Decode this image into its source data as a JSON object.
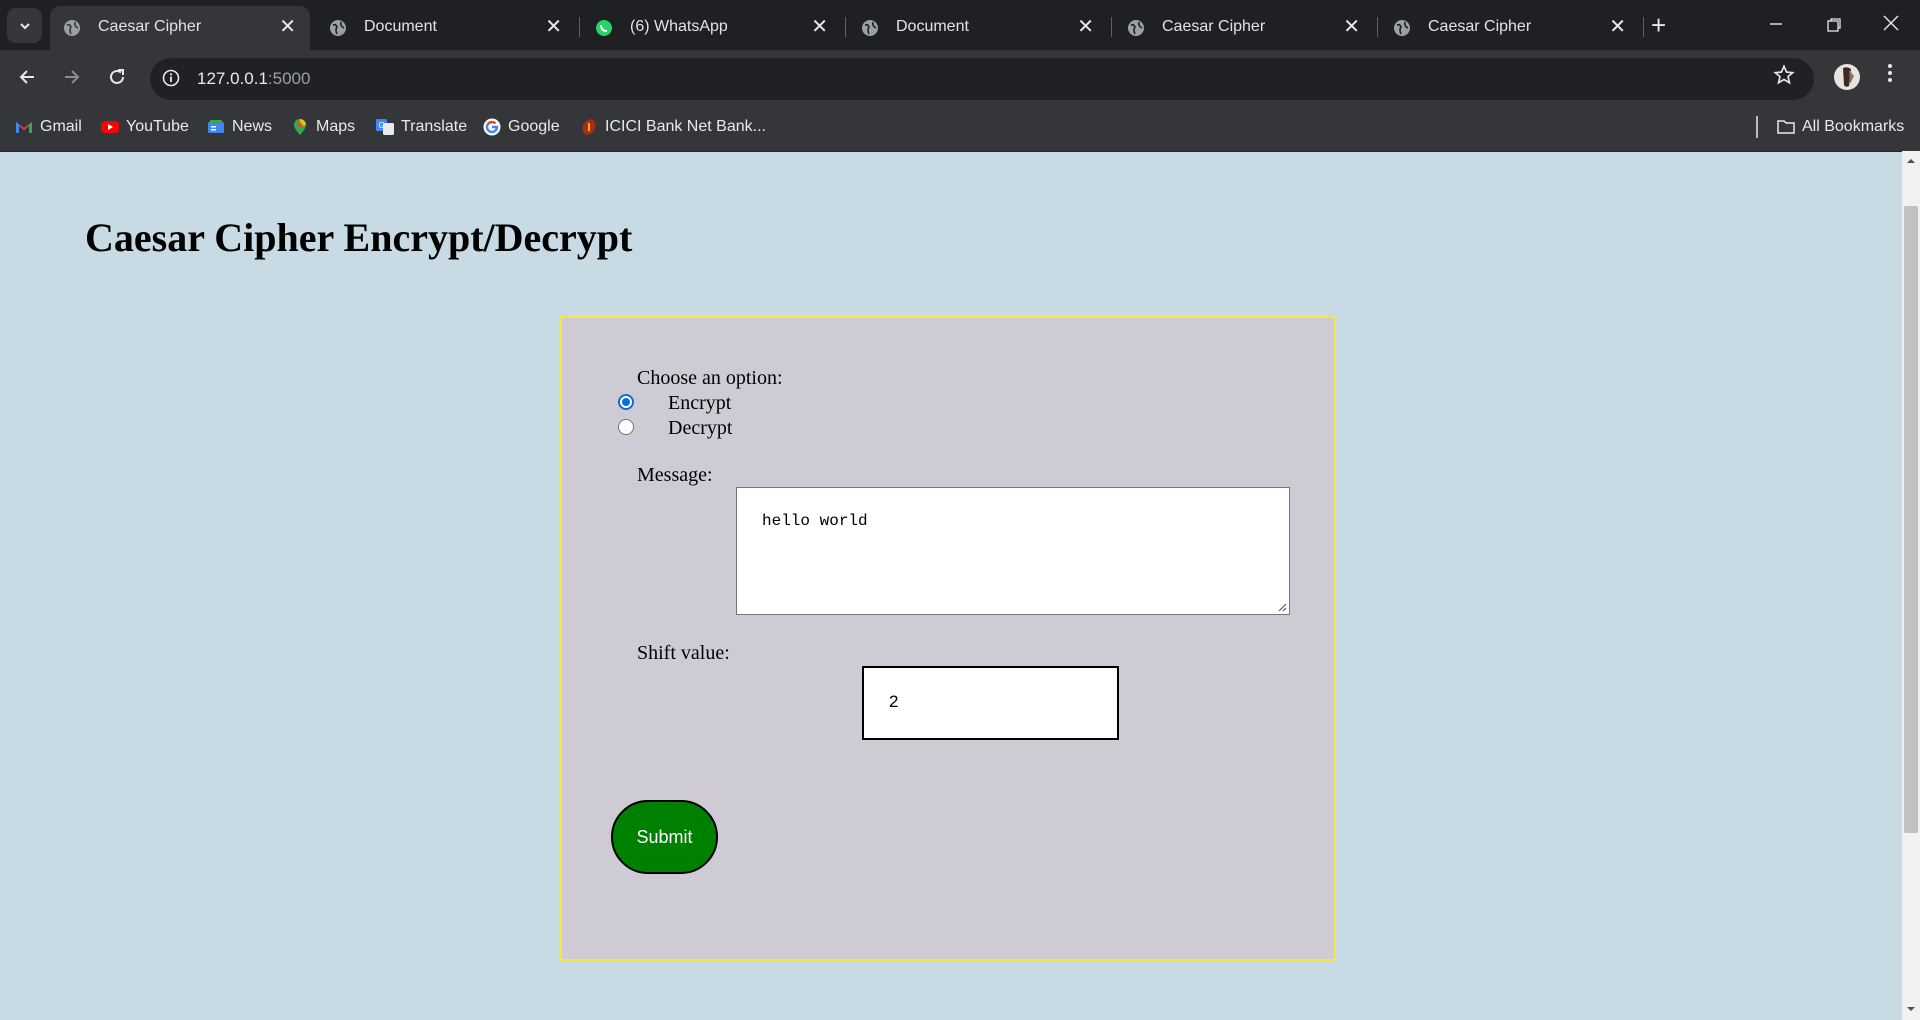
{
  "browser": {
    "tabs": [
      {
        "title": "Caesar Cipher",
        "icon": "globe-icon",
        "active": true
      },
      {
        "title": "Document",
        "icon": "globe-icon",
        "active": false
      },
      {
        "title": "(6) WhatsApp",
        "icon": "whatsapp-icon",
        "active": false
      },
      {
        "title": "Document",
        "icon": "globe-icon",
        "active": false
      },
      {
        "title": "Caesar Cipher",
        "icon": "globe-icon",
        "active": false
      },
      {
        "title": "Caesar Cipher",
        "icon": "globe-icon",
        "active": false
      }
    ],
    "address": {
      "host": "127.0.0.1",
      "port": ":5000"
    },
    "bookmarks": [
      {
        "label": "Gmail",
        "icon": "gmail-icon"
      },
      {
        "label": "YouTube",
        "icon": "youtube-icon"
      },
      {
        "label": "News",
        "icon": "news-icon"
      },
      {
        "label": "Maps",
        "icon": "maps-icon"
      },
      {
        "label": "Translate",
        "icon": "translate-icon"
      },
      {
        "label": "Google",
        "icon": "google-icon"
      },
      {
        "label": "ICICI Bank Net Bank...",
        "icon": "icici-icon"
      }
    ],
    "all_bookmarks": "All Bookmarks"
  },
  "page": {
    "title": "Caesar Cipher Encrypt/Decrypt",
    "form": {
      "option_label": "Choose an option:",
      "options": [
        {
          "label": "Encrypt",
          "checked": true
        },
        {
          "label": "Decrypt",
          "checked": false
        }
      ],
      "message_label": "Message:",
      "message_value": "hello world",
      "shift_label": "Shift value:",
      "shift_value": "2",
      "submit_label": "Submit"
    }
  },
  "colors": {
    "page_background": "#c8dae3",
    "form_background": "#cfcbd5",
    "form_border": "#f2e84a",
    "submit_background": "#008000",
    "radio_accent": "#0b6ddc"
  }
}
